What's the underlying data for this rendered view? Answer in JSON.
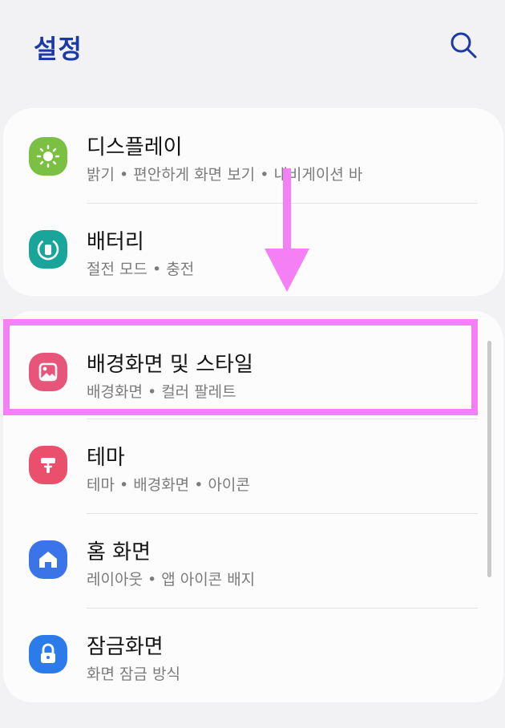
{
  "header": {
    "title": "설정"
  },
  "card1": {
    "items": [
      {
        "title": "디스플레이",
        "subtitle": "밝기 • 편안하게 화면 보기 • 내비게이션 바",
        "icon": "sun-icon",
        "color": "#7bc043"
      },
      {
        "title": "배터리",
        "subtitle": "절전 모드 • 충전",
        "icon": "battery-icon",
        "color": "#1aa59a"
      }
    ]
  },
  "card2": {
    "items": [
      {
        "title": "배경화면 및 스타일",
        "subtitle": "배경화면 • 컬러 팔레트",
        "icon": "wallpaper-icon",
        "color": "#e8557a"
      },
      {
        "title": "테마",
        "subtitle": "테마 • 배경화면 • 아이콘",
        "icon": "paint-roller-icon",
        "color": "#ea4f6b"
      },
      {
        "title": "홈 화면",
        "subtitle": "레이아웃 • 앱 아이콘 배지",
        "icon": "home-icon",
        "color": "#3b73e8"
      },
      {
        "title": "잠금화면",
        "subtitle": "화면 잠금 방식",
        "icon": "lock-icon",
        "color": "#2b7bea"
      }
    ]
  },
  "annotation": {
    "color": "#f57ff5",
    "arrow_icon": "down-arrow-icon"
  }
}
